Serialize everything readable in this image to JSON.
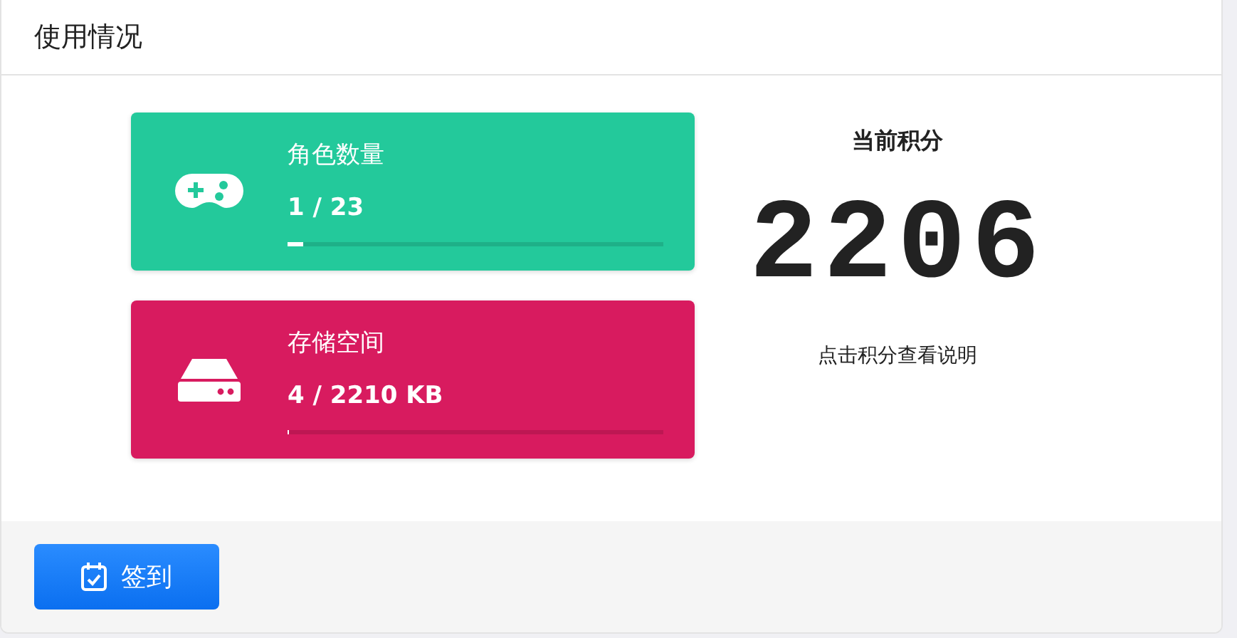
{
  "panel": {
    "title": "使用情况"
  },
  "stats": [
    {
      "kind": "game",
      "label": "角色数量",
      "reading": "1 / 23",
      "level": 0.043,
      "color": "#23c99b"
    },
    {
      "kind": "storage",
      "label": "存储空间",
      "reading": "4 / 2210 KB",
      "level": 0.002,
      "color": "#d81b5f"
    }
  ],
  "points": {
    "title": "当前积分",
    "value": "2206",
    "hint": "点击积分查看说明"
  },
  "footer": {
    "button": "签到"
  }
}
